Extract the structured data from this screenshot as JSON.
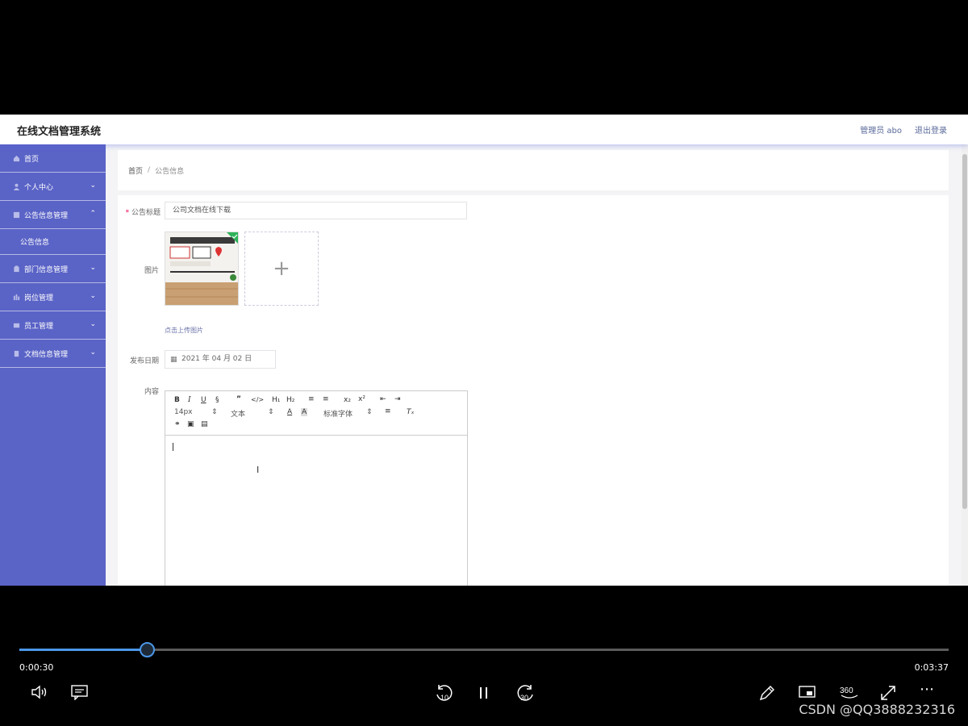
{
  "header": {
    "app_title": "在线文档管理系统",
    "admin": "管理员 abo",
    "logout": "退出登录"
  },
  "sidebar": {
    "items": [
      {
        "label": "首页",
        "icon": "home-icon"
      },
      {
        "label": "个人中心",
        "icon": "user-icon"
      },
      {
        "label": "公告信息管理",
        "icon": "notice-icon",
        "expanded": true
      },
      {
        "label": "公告信息",
        "sub": true
      },
      {
        "label": "部门信息管理",
        "icon": "department-icon"
      },
      {
        "label": "岗位管理",
        "icon": "post-icon"
      },
      {
        "label": "员工管理",
        "icon": "employee-icon"
      },
      {
        "label": "文档信息管理",
        "icon": "document-icon"
      }
    ]
  },
  "breadcrumb": {
    "home": "首页",
    "sep": "/",
    "current": "公告信息"
  },
  "form": {
    "title_label": "公告标题",
    "title_value": "公司文档在线下载",
    "image_label": "图片",
    "upload_hint": "点击上传图片",
    "date_label": "发布日期",
    "date_value": "2021 年 04 月 02 日",
    "content_label": "内容"
  },
  "editor": {
    "font_size": "14px",
    "block_type": "文本",
    "font_family": "标准字体"
  },
  "player": {
    "current_time": "0:00:30",
    "total_time": "0:03:37",
    "progress": 0.138,
    "rewind_label": "10",
    "forward_label": "30",
    "vr_label": "360"
  },
  "watermark": "CSDN @QQ3888232316",
  "colors": {
    "sidebar": "#5a63c6",
    "accent": "#4b97e8"
  }
}
